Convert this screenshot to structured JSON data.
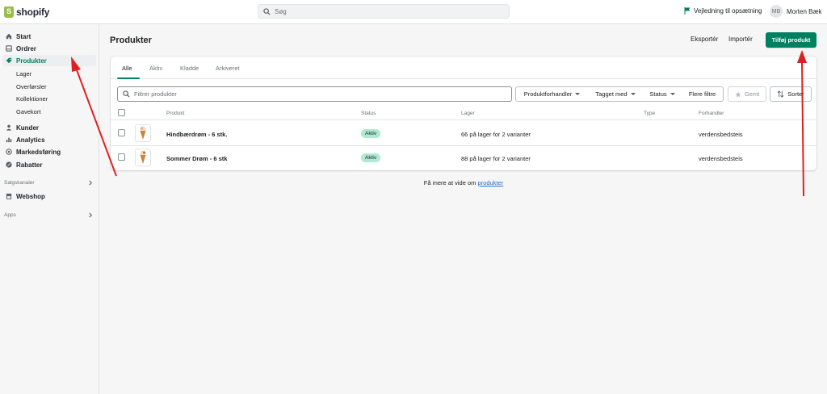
{
  "brand": {
    "logo_text": "shopify",
    "accent": "#008060"
  },
  "topbar": {
    "search_placeholder": "Søg",
    "guide": "Vejledning til opsætning",
    "user_initials": "MB",
    "user_name": "Morten Bæk"
  },
  "sidebar": {
    "main": [
      {
        "label": "Start",
        "icon": "home-icon"
      },
      {
        "label": "Ordrer",
        "icon": "inbox-icon"
      },
      {
        "label": "Produkter",
        "icon": "tag-icon",
        "active": true
      }
    ],
    "sub": [
      "Lager",
      "Overførsler",
      "Kollektioner",
      "Gavekort"
    ],
    "main2": [
      {
        "label": "Kunder",
        "icon": "person-icon"
      },
      {
        "label": "Analytics",
        "icon": "bar-chart-icon"
      },
      {
        "label": "Markedsføring",
        "icon": "target-icon"
      },
      {
        "label": "Rabatter",
        "icon": "discount-icon"
      }
    ],
    "sales_channels_heading": "Salgskanaler",
    "webshop": "Webshop",
    "apps_heading": "Apps"
  },
  "header": {
    "title": "Produkter",
    "export": "Eksportér",
    "import": "Importér",
    "add_product": "Tilføj produkt"
  },
  "tabs": [
    "Alle",
    "Aktiv",
    "Kladde",
    "Arkiveret"
  ],
  "filters": {
    "placeholder": "Filtrer produkter",
    "vendor": "Produktforhandler",
    "tagged": "Tagget med",
    "status": "Status",
    "more": "Flere filtre",
    "saved": "Gemt",
    "sort": "Sorter"
  },
  "table": {
    "columns": [
      "Produkt",
      "Status",
      "Lager",
      "Type",
      "Forhandler"
    ],
    "rows": [
      {
        "name": "Hindbærdrøm - 6 stk.",
        "status": "Aktiv",
        "inventory": "66 på lager for 2 varianter",
        "type": "",
        "vendor": "verdensbedsteis"
      },
      {
        "name": "Sommer Drøm - 6 stk",
        "status": "Aktiv",
        "inventory": "88 på lager for 2 varianter",
        "type": "",
        "vendor": "verdensbedsteis"
      }
    ]
  },
  "footer": {
    "text": "Få mere at vide om",
    "link": "produkter"
  },
  "annotation_color": "#e02020"
}
